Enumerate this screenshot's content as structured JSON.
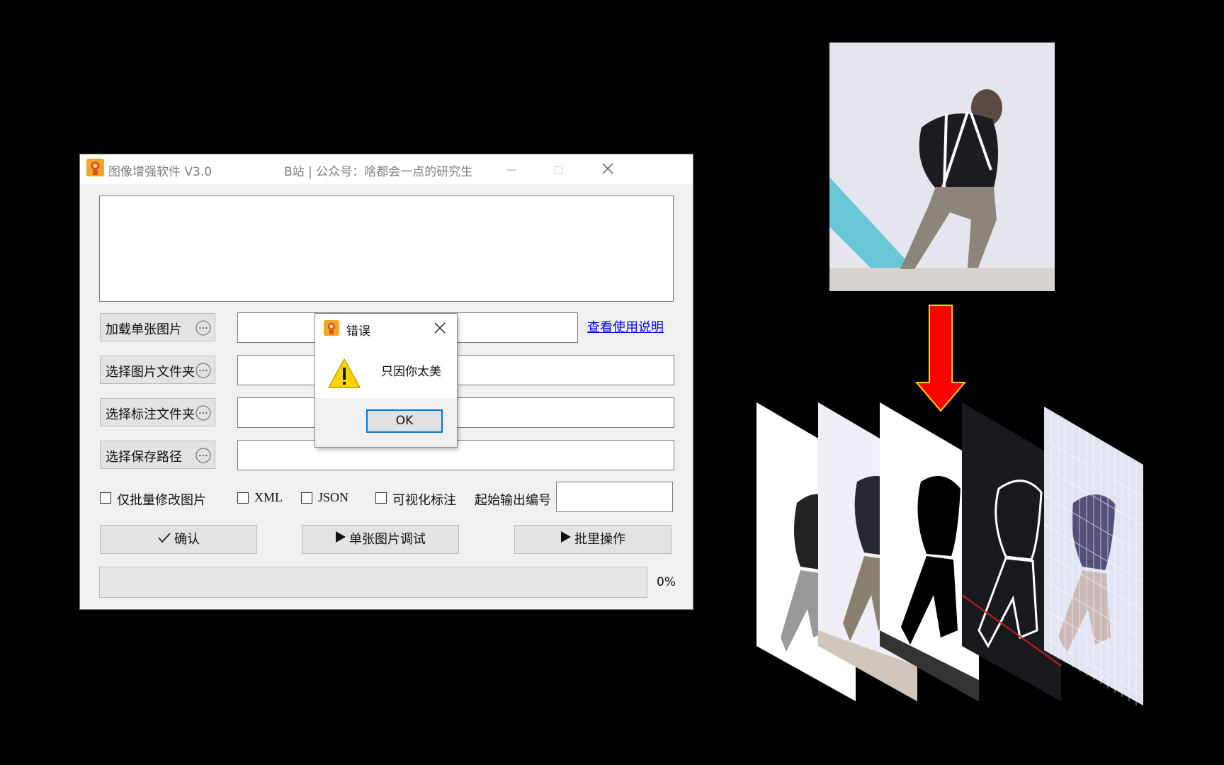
{
  "window": {
    "title": "图像增强软件 V3.0",
    "subtitle": "B站 | 公众号：啥都会一点的研究生"
  },
  "buttons": {
    "load_single": "加载单张图片",
    "select_image_folder": "选择图片文件夹",
    "select_label_folder": "选择标注文件夹",
    "select_save_path": "选择保存路径"
  },
  "help_link": "查看使用说明",
  "options": {
    "batch_modify_only": "仅批量修改图片",
    "xml": "XML",
    "json": "JSON",
    "visualize_labels": "可视化标注",
    "start_number_label": "起始输出编号"
  },
  "actions": {
    "confirm": "确认",
    "single_debug": "单张图片调试",
    "batch": "批里操作"
  },
  "progress": {
    "percent_text": "0%",
    "value": 0
  },
  "dialog": {
    "title": "错误",
    "message": "只因你太美",
    "ok_label": "OK"
  },
  "icons": {
    "app": "orange-avatar-icon",
    "warning": "warning-triangle-icon",
    "minimize": "minimize-icon",
    "maximize": "maximize-icon",
    "close": "close-icon",
    "ellipsis": "ellipsis-circle-icon",
    "check": "checkmark-icon",
    "play": "play-triangle-icon"
  },
  "colors": {
    "window_bg": "#f0f0f0",
    "link": "#0000ee",
    "ok_border": "#0078d7",
    "arrow": "#ff0000",
    "warning": "#ffd400"
  }
}
